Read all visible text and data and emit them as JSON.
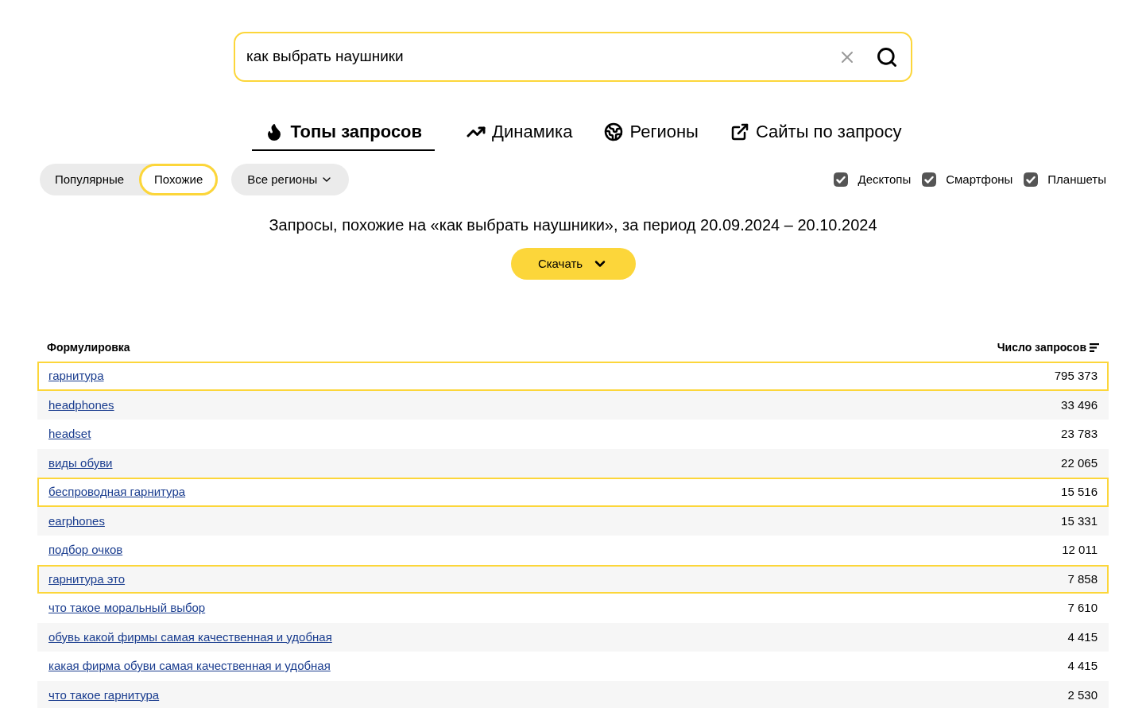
{
  "search": {
    "value": "как выбрать наушники"
  },
  "tabs": [
    {
      "label": "Топы запросов",
      "kind": "flame",
      "selected": true
    },
    {
      "label": "Динамика",
      "kind": "trend",
      "selected": false
    },
    {
      "label": "Регионы",
      "kind": "globe",
      "selected": false
    },
    {
      "label": "Сайты по запросу",
      "kind": "external",
      "selected": false
    }
  ],
  "modes": [
    {
      "label": "Популярные",
      "selected": false
    },
    {
      "label": "Похожие",
      "selected": true
    }
  ],
  "region_select": {
    "label": "Все регионы"
  },
  "devices": [
    {
      "label": "Десктопы",
      "checked": true
    },
    {
      "label": "Смартфоны",
      "checked": true
    },
    {
      "label": "Планшеты",
      "checked": true
    }
  ],
  "heading": "Запросы, похожие на «как выбрать наушники», за период 20.09.2024 – 20.10.2024",
  "download_button": "Скачать",
  "table": {
    "columns": [
      "Формулировка",
      "Число запросов"
    ],
    "rows": [
      {
        "query": "гарнитура",
        "count": "795 373",
        "highlighted": true
      },
      {
        "query": "headphones",
        "count": "33 496",
        "highlighted": false
      },
      {
        "query": "headset",
        "count": "23 783",
        "highlighted": false
      },
      {
        "query": "виды обуви",
        "count": "22 065",
        "highlighted": false
      },
      {
        "query": "беспроводная гарнитура",
        "count": "15 516",
        "highlighted": true
      },
      {
        "query": "earphones",
        "count": "15 331",
        "highlighted": false
      },
      {
        "query": "подбор очков",
        "count": "12 011",
        "highlighted": false
      },
      {
        "query": "гарнитура это",
        "count": "7 858",
        "highlighted": true
      },
      {
        "query": "что такое моральный выбор",
        "count": "7 610",
        "highlighted": false
      },
      {
        "query": "обувь какой фирмы самая качественная и удобная",
        "count": "4 415",
        "highlighted": false
      },
      {
        "query": "какая фирма обуви самая качественная и удобная",
        "count": "4 415",
        "highlighted": false
      },
      {
        "query": "что такое гарнитура",
        "count": "2 530",
        "highlighted": false
      }
    ]
  }
}
